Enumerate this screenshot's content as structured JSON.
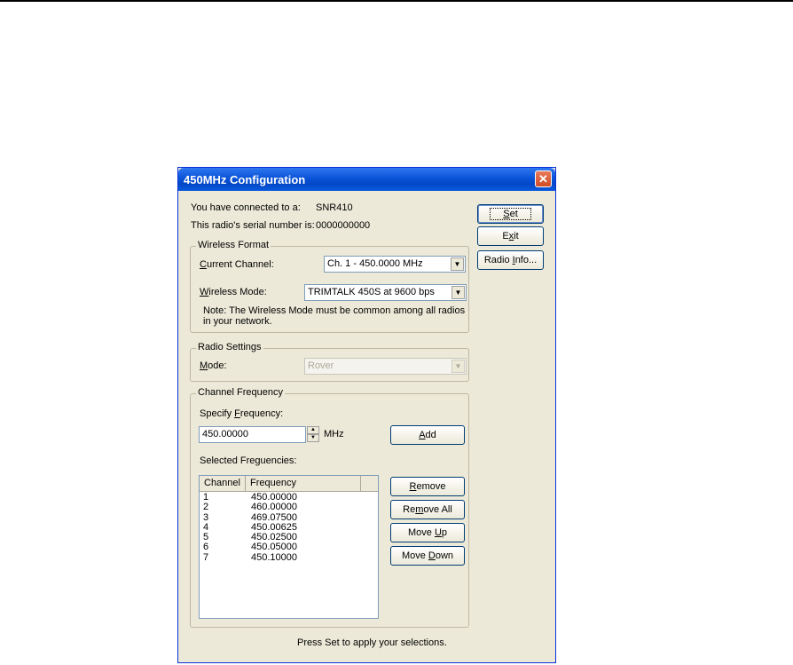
{
  "window": {
    "title": "450MHz Configuration",
    "close_glyph": "✕"
  },
  "info": {
    "connected_label": "You have connected to a:",
    "connected_value": "SNR410",
    "serial_label": "This radio's serial number is:",
    "serial_value": "0000000000"
  },
  "buttons": {
    "set": {
      "pre": "",
      "key": "S",
      "post": "et"
    },
    "exit": {
      "pre": "E",
      "key": "x",
      "post": "it"
    },
    "radio_info": {
      "pre": "Radio ",
      "key": "I",
      "post": "nfo..."
    }
  },
  "wireless_format": {
    "title": "Wireless Format",
    "channel_label": {
      "key": "C",
      "post": "urrent Channel:"
    },
    "channel_value": "Ch.  1 - 450.0000 MHz",
    "mode_label": {
      "key": "W",
      "post": "ireless Mode:"
    },
    "mode_value": "TRIMTALK 450S at 9600 bps",
    "note_line1": "Note: The Wireless Mode must be common among all radios",
    "note_line2": "in your network."
  },
  "radio_settings": {
    "title": "Radio Settings",
    "mode_label": {
      "key": "M",
      "post": "ode:"
    },
    "mode_value": "Rover"
  },
  "channel_frequency": {
    "title": "Channel Frequency",
    "specify_label": {
      "pre": "Specify ",
      "key": "F",
      "post": "requency:"
    },
    "frequency_value": "450.00000",
    "unit": "MHz",
    "add": {
      "key": "A",
      "post": "dd"
    },
    "selected_label": "Selected Freguencies:",
    "columns": [
      "Channel",
      "Frequency"
    ],
    "rows": [
      {
        "channel": "1",
        "frequency": "450.00000"
      },
      {
        "channel": "2",
        "frequency": "460.00000"
      },
      {
        "channel": "3",
        "frequency": "469.07500"
      },
      {
        "channel": "4",
        "frequency": "450.00625"
      },
      {
        "channel": "5",
        "frequency": "450.02500"
      },
      {
        "channel": "6",
        "frequency": "450.05000"
      },
      {
        "channel": "7",
        "frequency": "450.10000"
      }
    ],
    "remove": {
      "key": "R",
      "post": "emove"
    },
    "remove_all": {
      "pre": "Re",
      "key": "m",
      "post": "ove All"
    },
    "move_up": {
      "pre": "Move ",
      "key": "U",
      "post": "p"
    },
    "move_down": {
      "pre": "Move ",
      "key": "D",
      "post": "own"
    }
  },
  "footer": "Press Set to apply your selections."
}
